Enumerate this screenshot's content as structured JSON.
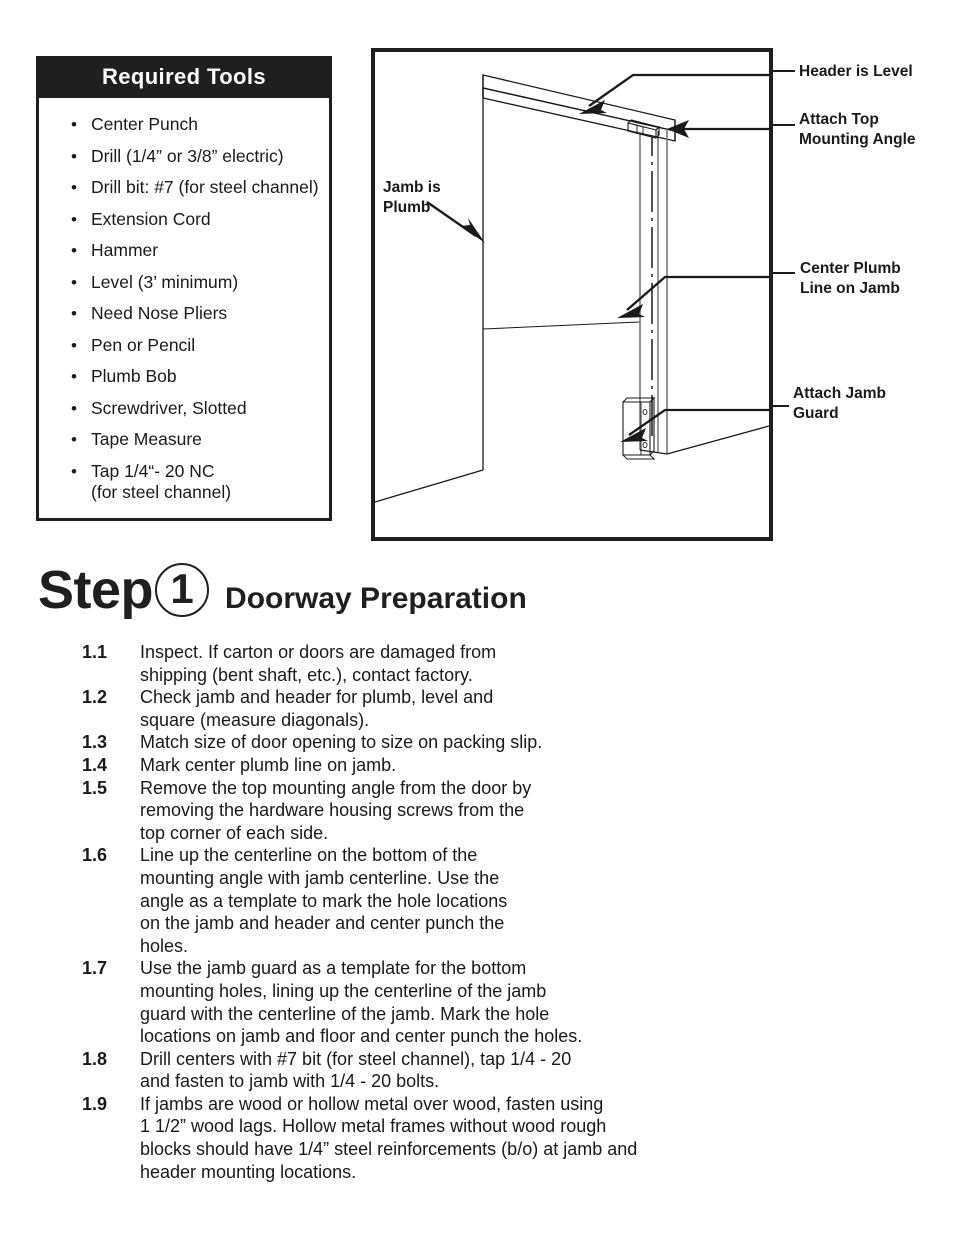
{
  "tools_panel": {
    "title": "Required Tools",
    "items": [
      {
        "label": "Center Punch"
      },
      {
        "label": "Drill (1/4” or 3/8” electric)"
      },
      {
        "label": "Drill bit:  #7 (for steel channel)"
      },
      {
        "label": "Extension Cord"
      },
      {
        "label": "Hammer"
      },
      {
        "label": "Level (3’ minimum)"
      },
      {
        "label": "Need Nose Pliers"
      },
      {
        "label": "Pen or Pencil"
      },
      {
        "label": "Plumb Bob"
      },
      {
        "label": "Screwdriver, Slotted"
      },
      {
        "label": "Tape Measure"
      },
      {
        "label": "Tap 1/4“- 20 NC",
        "sub": "(for steel channel)"
      }
    ]
  },
  "diagram": {
    "name": "doorway-isometric-diagram",
    "callouts": {
      "header_is_level": "Header is Level",
      "attach_top_mounting_angle": "Attach Top\nMounting Angle",
      "jamb_is_plumb": "Jamb is\nPlumb",
      "center_plumb_line_on_jamb": "Center Plumb\nLine on Jamb",
      "attach_jamb_guard": "Attach Jamb\nGuard"
    },
    "line_color": "#1a1a1a"
  },
  "step": {
    "word": "Step",
    "number": "1",
    "title": "Doorway Preparation"
  },
  "instructions": [
    {
      "num": "1.1",
      "text": "Inspect.  If carton or doors are damaged from\nshipping (bent shaft, etc.), contact factory."
    },
    {
      "num": "1.2",
      "text": "Check jamb and header for plumb, level and\nsquare (measure diagonals)."
    },
    {
      "num": "1.3",
      "text": "Match size of door opening to size on packing slip."
    },
    {
      "num": "1.4",
      "text": "Mark center plumb line on jamb."
    },
    {
      "num": "1.5",
      "text": "Remove the top mounting angle from the door by\nremoving the hardware housing screws from the\ntop corner of each side."
    },
    {
      "num": "1.6",
      "text": "Line up the centerline on the bottom of the\nmounting angle with jamb centerline.  Use the\nangle as a template to mark the hole locations\non the jamb and header and center punch the\nholes."
    },
    {
      "num": "1.7",
      "text": "Use the jamb guard as a template for the bottom\nmounting holes, lining up the centerline of the jamb\nguard with the centerline of the jamb.  Mark the hole\nlocations on jamb and floor and center punch the holes."
    },
    {
      "num": "1.8",
      "text": "Drill centers with #7 bit (for steel channel), tap 1/4 - 20\nand fasten to jamb with 1/4 - 20 bolts."
    },
    {
      "num": "1.9",
      "text": "If jambs are wood or hollow metal over wood, fasten using\n1 1/2” wood lags.  Hollow metal frames without wood rough\nblocks should have 1/4” steel reinforcements (b/o) at jamb and\nheader mounting locations."
    }
  ]
}
